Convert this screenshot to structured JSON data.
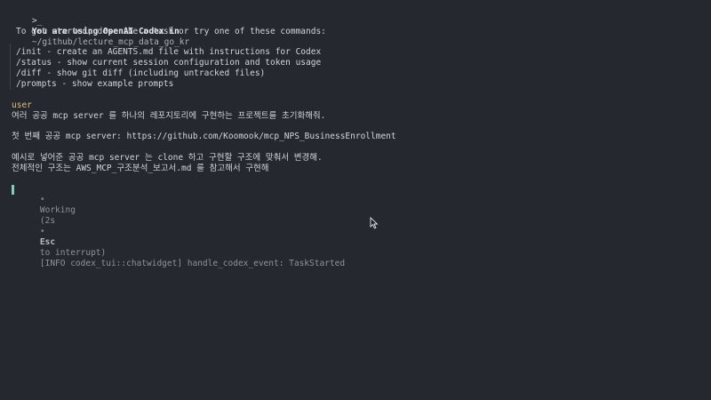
{
  "banner": {
    "prompt_symbol": ">_",
    "title": "You are using OpenAI Codex in",
    "path": "~/github/lecture_mcp_data_go_kr"
  },
  "hint": "To get started, describe a task or try one of these commands:",
  "commands": [
    "/init - create an AGENTS.md file with instructions for Codex",
    "/status - show current session configuration and token usage",
    "/diff - show git diff (including untracked files)",
    "/prompts - show example prompts"
  ],
  "user": {
    "label": "user",
    "messages": [
      "여러 공공 mcp server 를 하나의 레포지토리에 구현하는 프로젝트를 초기화해줘.",
      "첫 번째 공공 mcp server: https://github.com/Koomook/mcp_NPS_BusinessEnrollment",
      "예시로 넣어준 공공 mcp server 는 clone 하고 구현할 구조에 맞춰서 변경해.",
      "전체적인 구조는 AWS_MCP_구조분석_보고서.md 를 참고해서 구현해"
    ]
  },
  "status": {
    "bullet": "•",
    "state": "Working",
    "elapsed": "(2s",
    "sep": "•",
    "key": "Esc",
    "interrupt": "to interrupt)",
    "log": "[INFO codex_tui::chatwidget] handle_codex_event: TaskStarted"
  },
  "colors": {
    "background": "#25282e",
    "foreground": "#d2d5da",
    "user_label": "#e0c07a",
    "working_accent": "#7fd0b8"
  }
}
